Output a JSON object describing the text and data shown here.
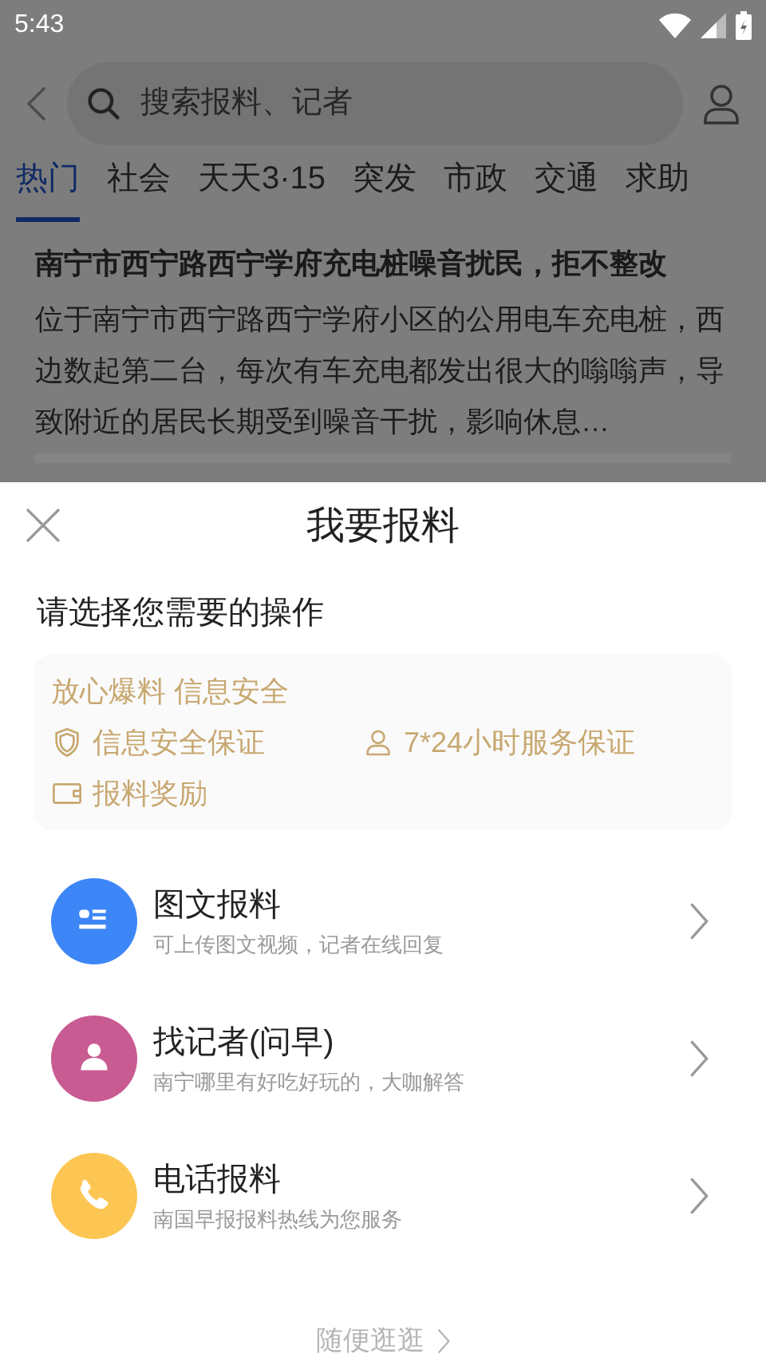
{
  "status_bar": {
    "time": "5:43"
  },
  "search": {
    "placeholder": "搜索报料、记者"
  },
  "tabs": [
    {
      "label": "热门",
      "selected": true
    },
    {
      "label": "社会",
      "selected": false
    },
    {
      "label": "天天3·15",
      "selected": false
    },
    {
      "label": "突发",
      "selected": false
    },
    {
      "label": "市政",
      "selected": false
    },
    {
      "label": "交通",
      "selected": false
    },
    {
      "label": "求助",
      "selected": false
    }
  ],
  "article": {
    "title": "南宁市西宁路西宁学府充电桩噪音扰民，拒不整改",
    "summary": "位于南宁市西宁路西宁学府小区的公用电车充电桩，西边数起第二台，每次有车充电都发出很大的嗡嗡声，导致附近的居民长期受到噪音干扰，影响休息…"
  },
  "sheet": {
    "title": "我要报料",
    "prompt": "请选择您需要的操作",
    "promise": {
      "heading": "放心爆料 信息安全",
      "features": [
        {
          "kind": "shield",
          "label": "信息安全保证"
        },
        {
          "kind": "person",
          "label": "7*24小时服务保证"
        },
        {
          "kind": "wallet",
          "label": "报料奖励"
        }
      ]
    },
    "options": [
      {
        "kind": "article",
        "color": "#3d86f7",
        "title": "图文报料",
        "subtitle": "可上传图文视频，记者在线回复"
      },
      {
        "kind": "person",
        "color": "#c95b93",
        "title": "找记者(问早)",
        "subtitle": "南宁哪里有好吃好玩的，大咖解答"
      },
      {
        "kind": "phone",
        "color": "#fdc653",
        "title": "电话报料",
        "subtitle": "南国早报报料热线为您服务"
      }
    ],
    "footer_link": "随便逛逛"
  }
}
